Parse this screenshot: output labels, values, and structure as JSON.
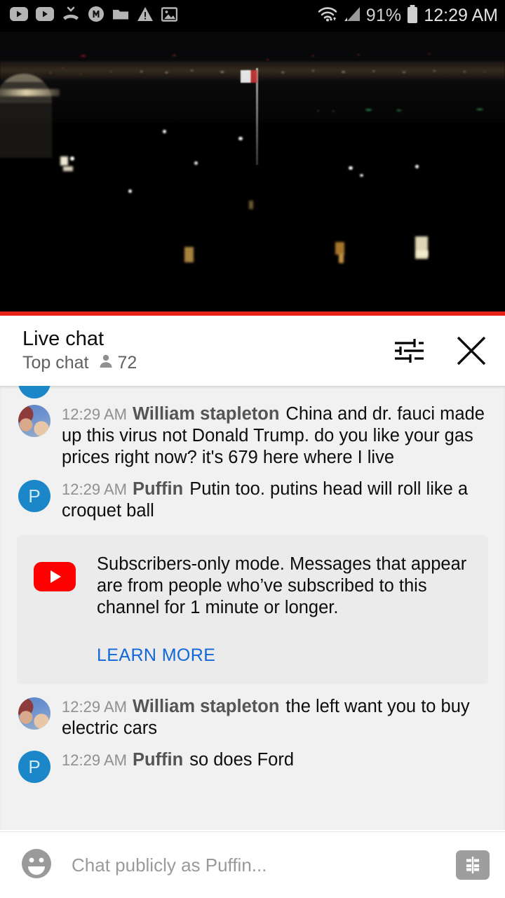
{
  "status_bar": {
    "icons_left": [
      "youtube-icon",
      "youtube-icon",
      "missed-call-icon",
      "monotype-m-icon",
      "folder-icon",
      "warning-triangle-icon",
      "image-icon"
    ],
    "wifi_icon": "wifi-icon",
    "signal_icon": "cell-signal-icon",
    "battery_percent": "91%",
    "battery_icon": "battery-icon",
    "time": "12:29 AM"
  },
  "video": {
    "description": "Live night webcam view of a city skyline with an illuminated memorial and a flag on a pole",
    "progress_percent": 100,
    "progress_color": "#e62117"
  },
  "chat_header": {
    "title": "Live chat",
    "mode": "Top chat",
    "viewer_count": "72",
    "viewer_icon": "person-icon",
    "settings_icon": "tune-sliders-icon",
    "close_icon": "close-x-icon"
  },
  "messages": [
    {
      "id": "clipped",
      "clipped": true,
      "timestamp": "",
      "author": "",
      "text": "",
      "avatar_type": "letter",
      "avatar_letter": "",
      "avatar_color": "#1b87c9"
    },
    {
      "id": "m1",
      "clipped": false,
      "timestamp": "12:29 AM",
      "author": "William stapleton",
      "text": "China and dr. fauci made up this virus not Donald Trump. do you like your gas prices right now? it's 679 here where I live",
      "avatar_type": "photo",
      "avatar_letter": "",
      "avatar_color": "#5b84c4"
    },
    {
      "id": "m2",
      "clipped": false,
      "timestamp": "12:29 AM",
      "author": "Puffin",
      "text": "Putin too. putins head will roll like a croquet ball",
      "avatar_type": "letter",
      "avatar_letter": "P",
      "avatar_color": "#1b87c9"
    }
  ],
  "banner": {
    "logo_icon": "youtube-logo-icon",
    "text": "Subscribers-only mode. Messages that appear are from people who’ve subscribed to this channel for 1 minute or longer.",
    "link_label": "LEARN MORE",
    "link_color": "#1267d8"
  },
  "messages_after": [
    {
      "id": "m3",
      "clipped": false,
      "timestamp": "12:29 AM",
      "author": "William stapleton",
      "text": "the left want you to buy electric cars",
      "avatar_type": "photo",
      "avatar_letter": "",
      "avatar_color": "#5b84c4"
    },
    {
      "id": "m4",
      "clipped": false,
      "timestamp": "12:29 AM",
      "author": "Puffin",
      "text": "so does Ford",
      "avatar_type": "letter",
      "avatar_letter": "P",
      "avatar_color": "#1b87c9"
    }
  ],
  "input_bar": {
    "emoji_icon": "emoji-smiley-icon",
    "placeholder": "Chat publicly as Puffin...",
    "value": "",
    "superchat_icon": "dollar-superchat-icon"
  }
}
